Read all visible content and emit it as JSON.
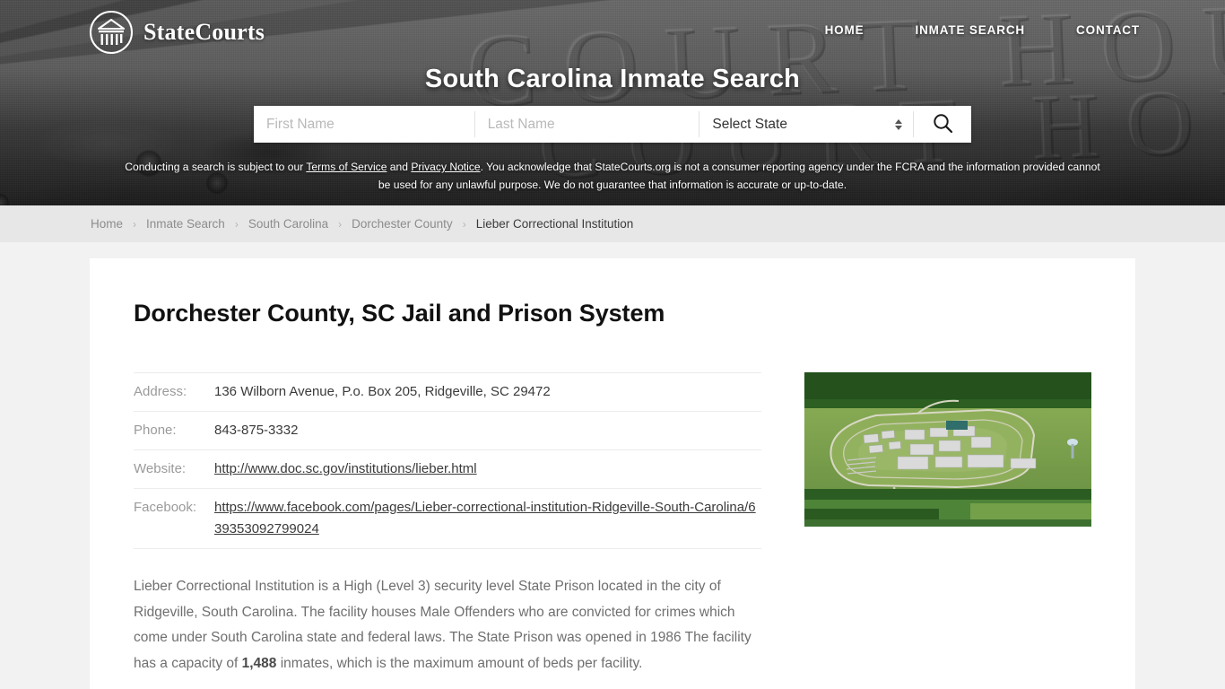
{
  "brand": {
    "name": "StateCourts",
    "logo_icon": "courthouse-circle-icon"
  },
  "nav": {
    "items": [
      {
        "label": "HOME"
      },
      {
        "label": "INMATE SEARCH"
      },
      {
        "label": "CONTACT"
      }
    ]
  },
  "hero": {
    "title": "South Carolina Inmate Search",
    "background_text": "COURT HOUSE"
  },
  "search": {
    "first_name_placeholder": "First Name",
    "first_name_value": "",
    "last_name_placeholder": "Last Name",
    "last_name_value": "",
    "state_selected": "Select State",
    "submit_icon": "search-icon"
  },
  "disclaimer": {
    "part1": "Conducting a search is subject to our ",
    "link1": "Terms of Service",
    "part2": " and ",
    "link2": "Privacy Notice",
    "part3": ". You acknowledge that StateCourts.org is not a consumer reporting agency under the FCRA and the information provided cannot be used for any unlawful purpose. We do not guarantee that information is accurate or up-to-date."
  },
  "breadcrumb": {
    "separator": "›",
    "items": [
      {
        "label": "Home",
        "current": false
      },
      {
        "label": "Inmate Search",
        "current": false
      },
      {
        "label": "South Carolina",
        "current": false
      },
      {
        "label": "Dorchester County",
        "current": false
      },
      {
        "label": "Lieber Correctional Institution",
        "current": true
      }
    ]
  },
  "main": {
    "page_title": "Dorchester County, SC Jail and Prison System",
    "facts": [
      {
        "label": "Address:",
        "value": "136 Wilborn Avenue, P.o. Box 205, Ridgeville, SC 29472",
        "is_link": false
      },
      {
        "label": "Phone:",
        "value": "843-875-3332",
        "is_link": false
      },
      {
        "label": "Website:",
        "value": "http://www.doc.sc.gov/institutions/lieber.html",
        "is_link": true
      },
      {
        "label": "Facebook:",
        "value": "https://www.facebook.com/pages/Lieber-correctional-institution-Ridgeville-South-Carolina/639353092799024",
        "is_link": true
      }
    ],
    "description_before": "Lieber Correctional Institution is a High (Level 3) security level State Prison located in the city of Ridgeville, South Carolina. The facility houses Male Offenders who are convicted for crimes which come under South Carolina state and federal laws. The State Prison was opened in 1986 The facility has a capacity of ",
    "description_capacity": "1,488",
    "description_after": " inmates, which is the maximum amount of beds per facility.",
    "photo_alt": "aerial-photo-of-lieber-correctional-institution"
  },
  "colors": {
    "page_background": "#f2f2f2",
    "card_background": "#ffffff",
    "breadcrumb_background": "#e7e7e7",
    "hero_background": "#3a3a3a",
    "body_text": "#6f6f6f",
    "muted_label": "#9a9a9a"
  }
}
